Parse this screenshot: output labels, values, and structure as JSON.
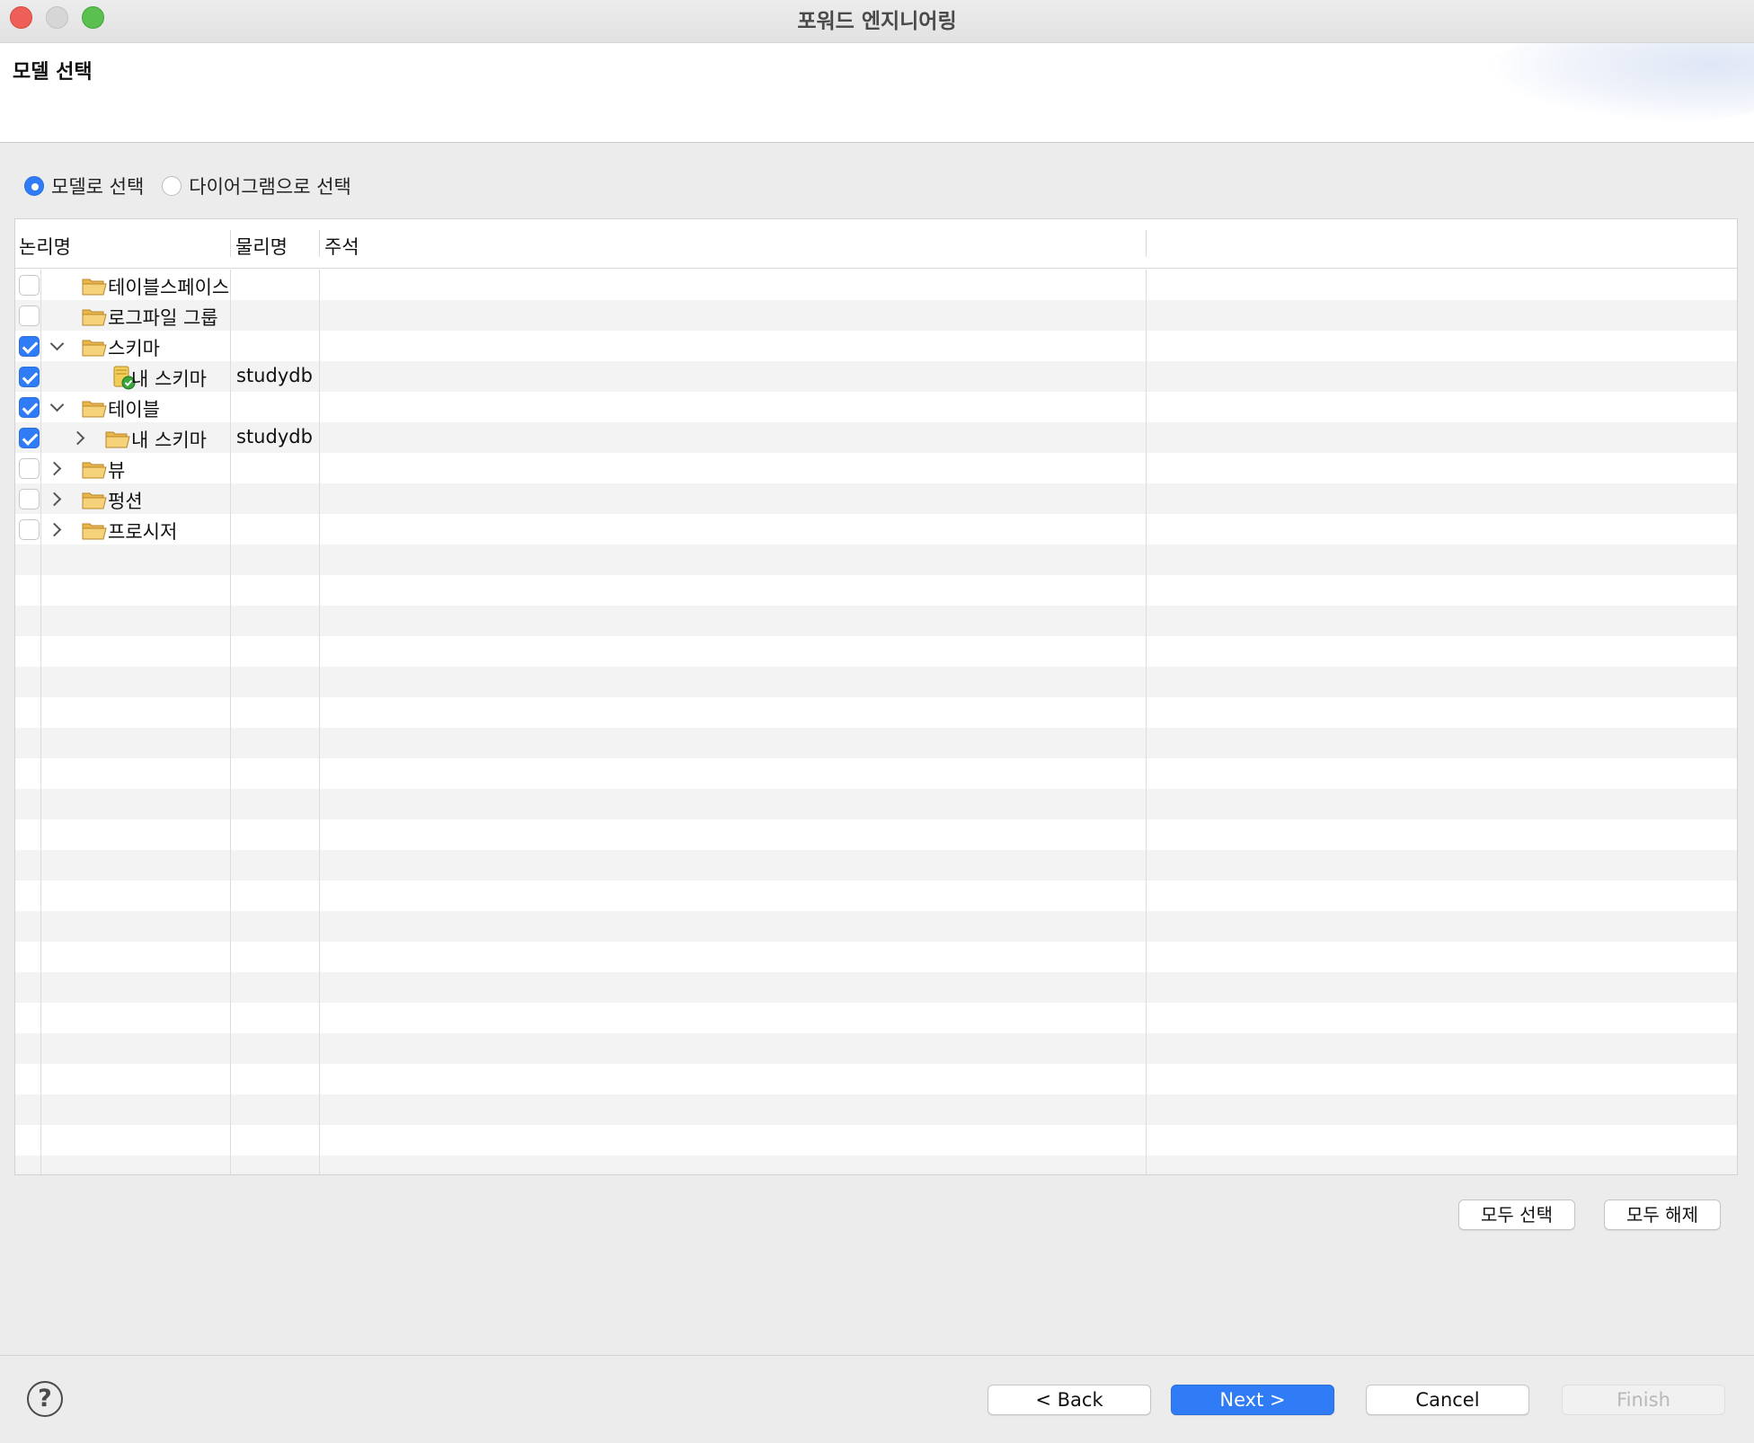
{
  "window": {
    "title": "포워드 엔지니어링"
  },
  "header": {
    "title": "모델 선택"
  },
  "selection_mode": {
    "options": [
      {
        "label": "모델로 선택",
        "selected": true
      },
      {
        "label": "다이어그램으로 선택",
        "selected": false
      }
    ]
  },
  "tree": {
    "columns": [
      "논리명",
      "물리명",
      "주석"
    ],
    "rows": [
      {
        "label": "테이블스페이스",
        "physical": "",
        "checked": false,
        "toggle": "none",
        "indent": 0,
        "icon": "folder-icon"
      },
      {
        "label": "로그파일 그룹",
        "physical": "",
        "checked": false,
        "toggle": "none",
        "indent": 0,
        "icon": "folder-icon"
      },
      {
        "label": "스키마",
        "physical": "",
        "checked": true,
        "toggle": "expanded",
        "indent": 0,
        "icon": "folder-icon"
      },
      {
        "label": "내 스키마",
        "physical": "studydb",
        "checked": true,
        "toggle": "none",
        "indent": 1,
        "icon": "schema-icon"
      },
      {
        "label": "테이블",
        "physical": "",
        "checked": true,
        "toggle": "expanded",
        "indent": 0,
        "icon": "folder-icon"
      },
      {
        "label": "내 스키마",
        "physical": "studydb",
        "checked": true,
        "toggle": "collapsed",
        "indent": 1,
        "icon": "folder-icon"
      },
      {
        "label": "뷰",
        "physical": "",
        "checked": false,
        "toggle": "collapsed",
        "indent": 0,
        "icon": "folder-icon"
      },
      {
        "label": "펑션",
        "physical": "",
        "checked": false,
        "toggle": "collapsed",
        "indent": 0,
        "icon": "folder-icon"
      },
      {
        "label": "프로시저",
        "physical": "",
        "checked": false,
        "toggle": "collapsed",
        "indent": 0,
        "icon": "folder-icon"
      }
    ]
  },
  "selection_buttons": {
    "select_all": "모두 선택",
    "deselect_all": "모두 해제"
  },
  "footer": {
    "help": "?",
    "back": "< Back",
    "next": "Next >",
    "cancel": "Cancel",
    "finish": "Finish"
  },
  "colors": {
    "accent": "#2f7cf6",
    "folder": "#f2c560",
    "alt_row": "#f3f3f3"
  }
}
